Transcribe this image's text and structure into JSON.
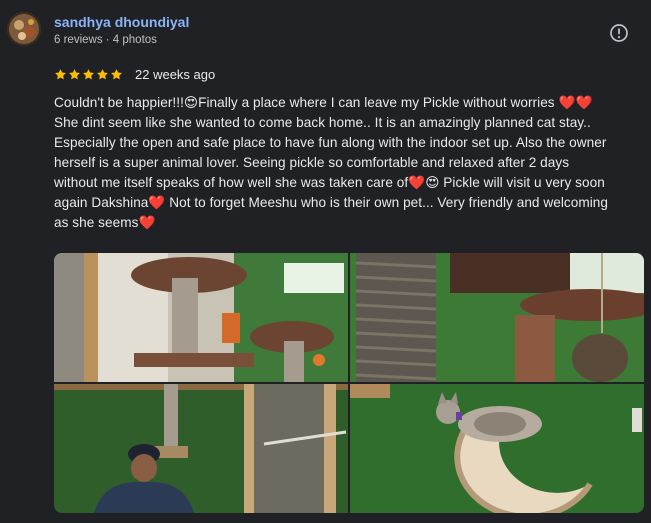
{
  "reviewer": {
    "name": "sandhya dhoundiyal",
    "meta": "6 reviews · 4 photos"
  },
  "review": {
    "stars": 5,
    "stars_color": "#fbbc04",
    "time": "22 weeks ago",
    "lines": [
      "Couldn't be happier!!!😍Finally a place where I can leave my Pickle without worries ❤️❤️",
      "She dint seem like she wanted to come back home.. It is an amazingly planned cat stay..",
      "Especially the open and safe place to have fun along with the indoor set up. Also the owner",
      "herself is a super animal lover. Seeing pickle so comfortable and relaxed after 2 days",
      "without me itself speaks of how well she was taken care of❤️😍 Pickle will visit u very soon",
      "again Dakshina❤️ Not to forget Meeshu who is their own pet... Very friendly and welcoming",
      "as she seems❤️"
    ]
  },
  "icons": {
    "more": "alert-circle-icon",
    "star": "star-icon"
  },
  "photos": [
    {
      "name": "photo-cat-tree-scratching-posts"
    },
    {
      "name": "photo-rope-scratching-post"
    },
    {
      "name": "photo-person-in-cat-enclosure"
    },
    {
      "name": "photo-cat-on-moon-bed"
    }
  ]
}
